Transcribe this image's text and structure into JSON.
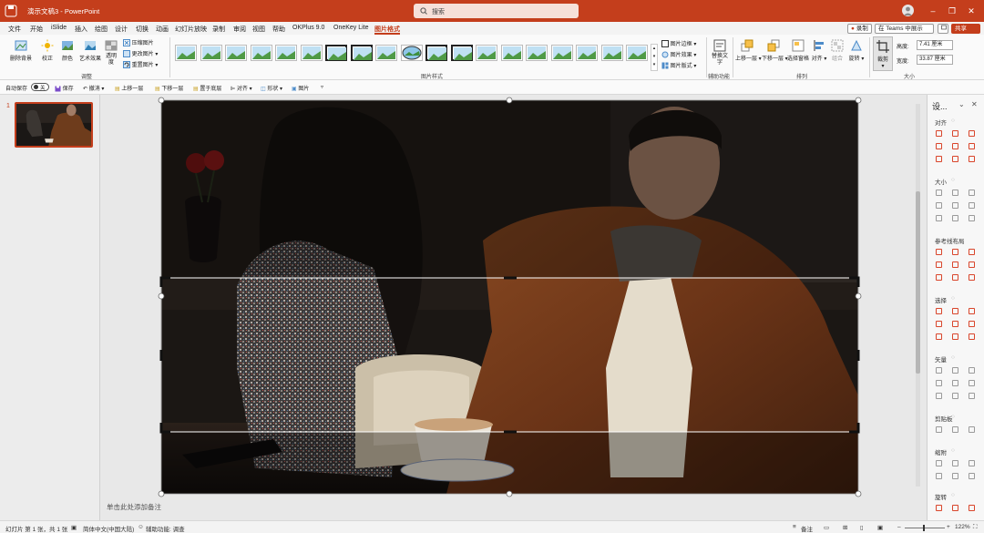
{
  "titlebar": {
    "doc_title": "演示文稿3 - PowerPoint",
    "search_placeholder": "搜索",
    "accent": "#c43e1c"
  },
  "menu": {
    "tabs": [
      "文件",
      "开始",
      "iSlide",
      "插入",
      "绘图",
      "设计",
      "切换",
      "动画",
      "幻灯片放映",
      "录制",
      "审阅",
      "视图",
      "帮助",
      "OKPlus 9.0",
      "OneKey Lite",
      "图片格式"
    ],
    "active_tab": "图片格式",
    "record_label": "录制",
    "teams_label": "在 Teams 中展示",
    "share_label": "共享"
  },
  "ribbon": {
    "remove_bg": "删除背景",
    "corrections": "校正",
    "color": "颜色",
    "artistic": "艺术效果",
    "transparency": "透明度",
    "compress": "压缩图片",
    "change_pic": "更改图片",
    "reset_pic": "重置图片",
    "group_adjust": "调整",
    "group_styles": "图片样式",
    "border": "图片边框",
    "effects": "图片效果",
    "layout": "图片版式",
    "alt_text": "替换文字",
    "group_access": "辅助功能",
    "bring_forward": "上移一层",
    "send_backward": "下移一层",
    "selection_pane": "选择窗格",
    "align": "对齐",
    "group_obj": "组合",
    "rotate": "旋转",
    "group_arrange": "排列",
    "crop": "裁剪",
    "height_label": "高度:",
    "height_value": "7.41 厘米",
    "width_label": "宽度:",
    "width_value": "33.87 厘米",
    "group_size": "大小"
  },
  "qat": {
    "autosave": "自动保存",
    "autosave_state": "关",
    "save": "保存",
    "undo": "撤消",
    "bring_forward": "上移一层",
    "send_backward": "下移一层",
    "send_to_back": "置于底层",
    "align": "对齐",
    "shapes": "形状",
    "picture": "图片"
  },
  "slides": {
    "number": "1"
  },
  "canvas": {
    "notes_placeholder": "单击此处添加备注"
  },
  "side_panel": {
    "title": "设...",
    "sections": [
      "对齐",
      "大小",
      "参考线布局",
      "选择",
      "矢量",
      "剪贴板",
      "缩附",
      "旋转"
    ]
  },
  "status": {
    "slide_info": "幻灯片 第 1 张，共 1 张",
    "language": "简体中文(中国大陆)",
    "accessibility": "辅助功能: 调查",
    "notes": "备注",
    "zoom": "122%"
  }
}
